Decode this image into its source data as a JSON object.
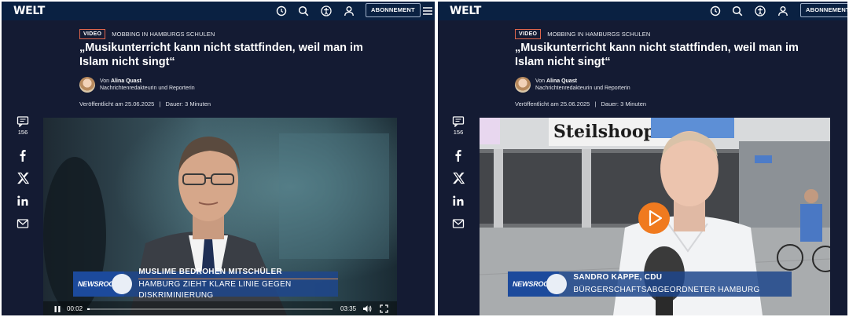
{
  "site": {
    "logo": "WELT",
    "subscribe_label": "ABONNEMENT"
  },
  "article": {
    "badge": "VIDEO",
    "kicker": "MOBBING IN HAMBURGS SCHULEN",
    "headline_line1": "„Musikunterricht kann nicht stattfinden, weil man im",
    "headline_line2": "Islam nicht singt“",
    "author_prefix": "Von",
    "author_name": "Alina Quast",
    "author_role": "Nachrichtenredakteurin und Reporterin",
    "published": "Veröffentlicht am 25.06.2025",
    "separator": "|",
    "duration": "Dauer: 3 Minuten"
  },
  "social": {
    "comment_count": "156",
    "icons": [
      "comment-icon",
      "facebook-icon",
      "x-icon",
      "linkedin-icon",
      "mail-icon"
    ]
  },
  "left_video": {
    "brand": "NEWSROOM",
    "lower_third_line1": "MUSLIME BEDROHEN MITSCHÜLER",
    "lower_third_line2": "HAMBURG ZIEHT KLARE LINIE GEGEN DISKRIMINIERUNG",
    "time_current": "00:02",
    "time_total": "03:35",
    "progress": 0.01
  },
  "right_video": {
    "brand": "NEWSROOM",
    "store_sign": "Steilshoop",
    "lower_third_line1": "SANDRO KAPPE, CDU",
    "lower_third_line2": "BÜRGERSCHAFTSABGEORDNETER HAMBURG"
  },
  "colors": {
    "page_bg": "#141b33",
    "topbar": "#0a2142",
    "accent_orange": "#f07a1f",
    "video_badge_border": "#e0664c",
    "lower_third_blue": "#1c4a9c"
  }
}
